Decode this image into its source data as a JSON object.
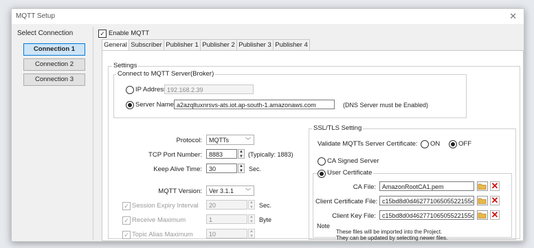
{
  "window": {
    "title": "MQTT Setup",
    "close": "✕"
  },
  "connections": {
    "title": "Select Connection",
    "items": [
      "Connection 1",
      "Connection 2",
      "Connection 3"
    ],
    "active_index": 0
  },
  "enable_mqtt": {
    "label": "Enable MQTT",
    "checked": true
  },
  "tabs": [
    "General",
    "Subscriber",
    "Publisher 1",
    "Publisher 2",
    "Publisher 3",
    "Publisher 4"
  ],
  "settings": {
    "group_title": "Settings",
    "server_group_title": "Connect to MQTT Server(Broker)",
    "ip_label": "IP Address",
    "ip_value": "192.168.2.39",
    "server_name_label": "Server Name",
    "server_name_value": "a2azqltuxnrsvs-ats.iot.ap-south-1.amazonaws.com",
    "dns_note": "(DNS Server must be Enabled)"
  },
  "general": {
    "protocol_label": "Protocol:",
    "protocol_value": "MQTTs",
    "tcp_port_label": "TCP Port Number:",
    "tcp_port_value": "8883",
    "tcp_port_hint": "(Typically: 1883)",
    "keep_alive_label": "Keep Alive Time:",
    "keep_alive_value": "30",
    "keep_alive_unit": "Sec.",
    "mqtt_version_label": "MQTT Version:",
    "mqtt_version_value": "Ver 3.1.1",
    "session_expiry_label": "Session Expiry Interval",
    "session_expiry_value": "20",
    "session_expiry_unit": "Sec.",
    "receive_max_label": "Receive Maximum",
    "receive_max_value": "1",
    "receive_max_unit": "Byte",
    "topic_alias_label": "Topic Alias Maximum",
    "topic_alias_value": "10"
  },
  "ssl": {
    "group_title": "SSL/TLS Setting",
    "validate_label": "Validate MQTTs Server Certificate:",
    "on_label": "ON",
    "off_label": "OFF",
    "ca_signed_label": "CA Signed Server",
    "user_cert_label": "User Certificate",
    "ca_file_label": "CA File:",
    "ca_file_value": "AmazonRootCA1.pem",
    "client_cert_label": "Client Certificate File:",
    "client_cert_value": "c15bd8d0d46277106505522155db0",
    "client_key_label": "Client Key File:",
    "client_key_value": "c15bd8d0d46277106505522155db0",
    "note_title": "Note",
    "note_line1": "These files will be imported into the Project.",
    "note_line2": "They can be updated by selecting newer files.",
    "delete_glyph": "✕"
  },
  "colors": {
    "accent": "#0078d7",
    "delete": "#d01010",
    "folder": "#e8b84a"
  }
}
